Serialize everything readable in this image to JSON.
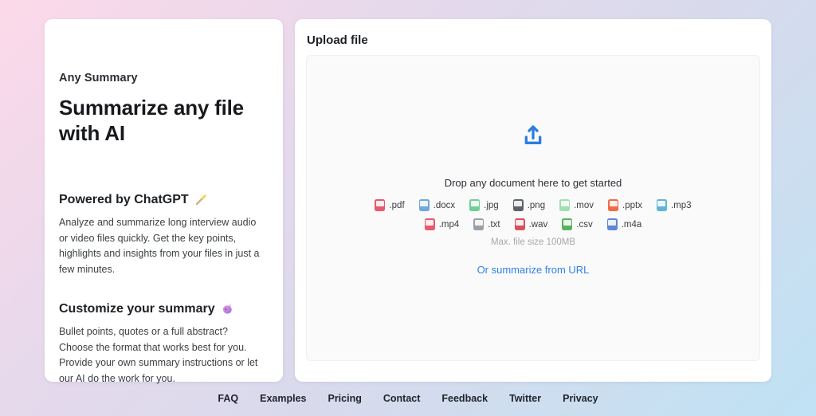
{
  "left_card": {
    "eyebrow": "Any Summary",
    "title": "Summarize any file with AI",
    "sections": [
      {
        "heading": "Powered by ChatGPT",
        "icon": "magic-wand",
        "body": "Analyze and summarize long interview audio or video files quickly. Get the key points, highlights and insights from your files in just a few minutes."
      },
      {
        "heading": "Customize your summary",
        "icon": "unicorn",
        "body": "Bullet points, quotes or a full abstract? Choose the format that works best for you. Provide your own summary instructions or let our AI do the work for you."
      }
    ]
  },
  "upload_panel": {
    "title": "Upload file",
    "drop_text": "Drop any document here to get started",
    "max_size_text": "Max. file size 100MB",
    "url_link_text": "Or summarize from URL",
    "accent_color": "#2b7de0",
    "file_types_row1": [
      {
        "ext": ".pdf",
        "color": "#e8586f"
      },
      {
        "ext": ".docx",
        "color": "#6fa8dc"
      },
      {
        "ext": ".jpg",
        "color": "#6fcf97"
      },
      {
        "ext": ".png",
        "color": "#5f6368"
      },
      {
        "ext": ".mov",
        "color": "#9fdfb0"
      },
      {
        "ext": ".pptx",
        "color": "#ed6c47"
      },
      {
        "ext": ".mp3",
        "color": "#63b3d8"
      }
    ],
    "file_types_row2": [
      {
        "ext": ".mp4",
        "color": "#e8586f"
      },
      {
        "ext": ".txt",
        "color": "#9aa0a6"
      },
      {
        "ext": ".wav",
        "color": "#d94f5c"
      },
      {
        "ext": ".csv",
        "color": "#57b35f"
      },
      {
        "ext": ".m4a",
        "color": "#5f86d8"
      }
    ]
  },
  "footer": {
    "links": [
      "FAQ",
      "Examples",
      "Pricing",
      "Contact",
      "Feedback",
      "Twitter",
      "Privacy"
    ]
  }
}
